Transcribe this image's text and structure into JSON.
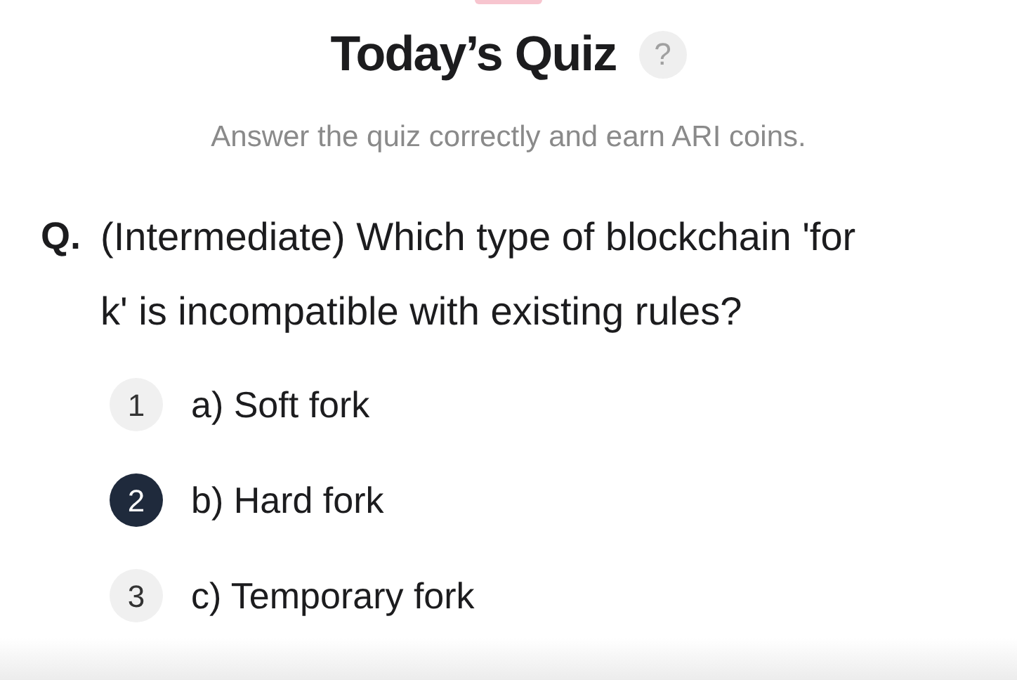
{
  "title": "Today’s Quiz",
  "help": "?",
  "subtitle": "Answer the quiz correctly and earn ARI coins.",
  "question": {
    "prefix": "Q.",
    "text": "(Intermediate) Which type of blockchain 'fork' is incompatible with existing rules?"
  },
  "options": [
    {
      "number": "1",
      "label": "a) Soft fork",
      "selected": false
    },
    {
      "number": "2",
      "label": "b) Hard fork",
      "selected": true
    },
    {
      "number": "3",
      "label": "c) Temporary fork",
      "selected": false
    }
  ]
}
